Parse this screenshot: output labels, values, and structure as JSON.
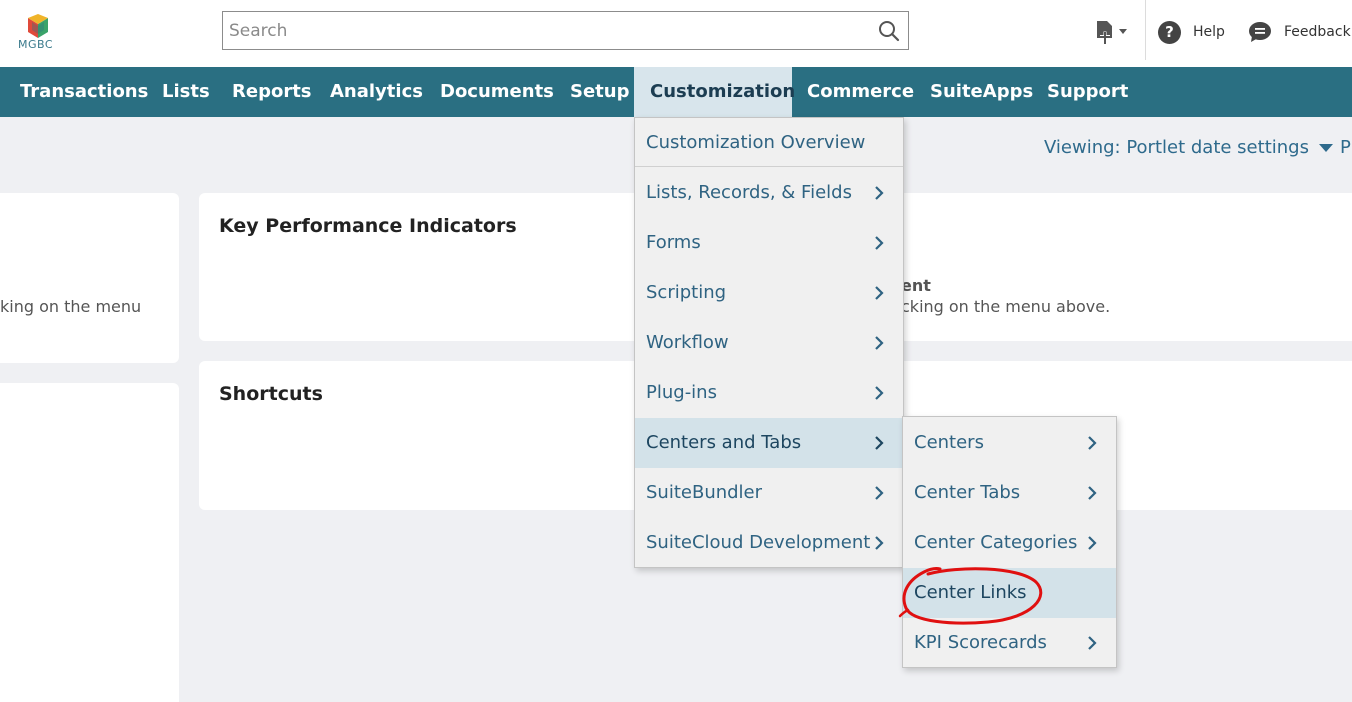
{
  "header": {
    "logo_text": "MGBC",
    "search_placeholder": "Search",
    "help_label": "Help",
    "feedback_label": "Feedback"
  },
  "nav": {
    "items": [
      "Transactions",
      "Lists",
      "Reports",
      "Analytics",
      "Documents",
      "Setup",
      "Customization",
      "Commerce",
      "SuiteApps",
      "Support"
    ],
    "active": "Customization"
  },
  "viewing": {
    "label": "Viewing: Portlet date settings",
    "extra": "P"
  },
  "cards": {
    "left_partial_text": "king on the menu",
    "kpi_title": "Key Performance Indicators",
    "right_partial_bold": "ent",
    "right_partial_text": "cking on the menu above.",
    "shortcuts_title": "Shortcuts"
  },
  "customization_menu": {
    "items": [
      "Customization Overview",
      "Lists, Records, & Fields",
      "Forms",
      "Scripting",
      "Workflow",
      "Plug-ins",
      "Centers and Tabs",
      "SuiteBundler",
      "SuiteCloud Development"
    ],
    "highlighted": "Centers and Tabs"
  },
  "centers_submenu": {
    "items": [
      "Centers",
      "Center Tabs",
      "Center Categories",
      "Center Links",
      "KPI Scorecards"
    ],
    "highlighted": "Center Links",
    "annotated": "Center Links"
  },
  "colors": {
    "nav_bg": "#2a6f82",
    "link": "#2f6382",
    "annotation": "#e01010"
  },
  "icons": [
    "search-icon",
    "create-new-icon",
    "help-icon",
    "feedback-icon",
    "chevron-right-icon",
    "caret-down-icon"
  ]
}
